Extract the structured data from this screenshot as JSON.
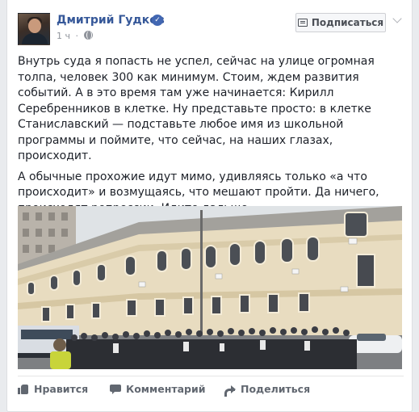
{
  "post": {
    "author": "Дмитрий Гудков",
    "time": "1 ч",
    "dot": "·",
    "subscribe_label": "Подписаться",
    "paragraphs": [
      "Внутрь суда я попасть не успел, сейчас на улице огромная толпа, человек 300 как минимум. Стоим, ждем развития событий. А в это время там уже начинается: Кирилл Серебренников в клетке. Ну представьте просто: в клетке Станиславский — подставьте любое имя из школьной программы и поймите, что сейчас, на наших глазах, происходит.",
      "А обычные прохожие идут мимо, удивляясь только «а что происходит» и возмущаясь, что мешают пройти. Да ничего, происходят репрессии. Идите дальше."
    ],
    "photo_alt": "Толпа людей у здания суда"
  },
  "actions": {
    "like": "Нравится",
    "comment": "Комментарий",
    "share": "Поделиться"
  },
  "colors": {
    "link": "#365899",
    "verified": "#4267b2",
    "muted": "#90949c",
    "action": "#616770"
  },
  "icons": [
    "verified-badge-icon",
    "globe-icon",
    "rss-icon",
    "chevron-down-icon",
    "like-icon",
    "comment-icon",
    "share-icon"
  ]
}
